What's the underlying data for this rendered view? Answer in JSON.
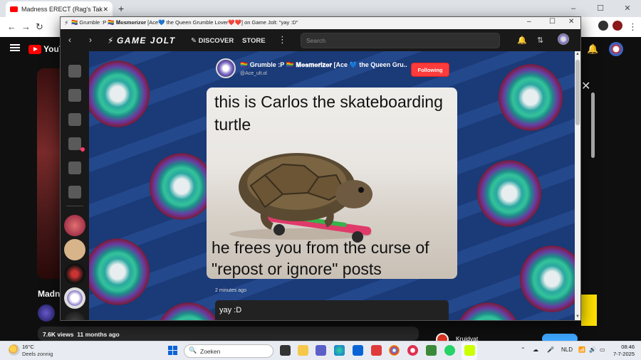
{
  "background_browser": {
    "tab_title": "Madness ERECT (Rag's Take)",
    "tab_close": "✕",
    "new_tab": "+",
    "youtube": {
      "logo_text": "YouTube",
      "video_title": "Madn",
      "views": "7.6K views",
      "age": "11 months ago",
      "ad_advertiser": "Kruidvat"
    }
  },
  "gamejolt_window": {
    "title": "🏳️‍🌈 Grumble :P 🏳️‍🌈 𝐌𝐞𝐬𝐦𝐞𝐫𝐢𝐳𝐞𝐫 [Ace💙 the Queen Grumble Lover❤️❤️] on Game Jolt: \"yay :D\"",
    "controls": {
      "minimize": "–",
      "maximize": "☐",
      "close": "✕"
    },
    "nav": {
      "back": "‹",
      "forward": "›",
      "logo": "GAME JOLT",
      "discover": "DISCOVER",
      "store": "STORE",
      "more": "⋮",
      "search_placeholder": "Search"
    },
    "post": {
      "author_name": "🏳️‍🌈 Grumble :P 🏳️‍🌈 𝐌𝐞𝐬𝐦𝐞𝐫𝐢𝐳𝐞𝐫 [Ace 💙 the Queen Gru...",
      "author_handle": "@Ace_ult.ol",
      "follow_label": "Following",
      "image_text_top": "this is Carlos the skateboarding turtle",
      "image_text_bottom": "he frees you from the curse of \"repost or ignore\" posts",
      "time": "2 minutes ago",
      "comment": "yay :D"
    }
  },
  "taskbar": {
    "temperature": "16°C",
    "condition": "Deels zonnig",
    "search_label": "Zoeken",
    "language": "NLD",
    "time": "08:46",
    "date": "7-7-2025"
  },
  "colors": {
    "follow_button": "#ff3b3b",
    "gamejolt_bg": "#191919",
    "youtube_red": "#ff0000",
    "windows_blue": "#0a64d6"
  }
}
